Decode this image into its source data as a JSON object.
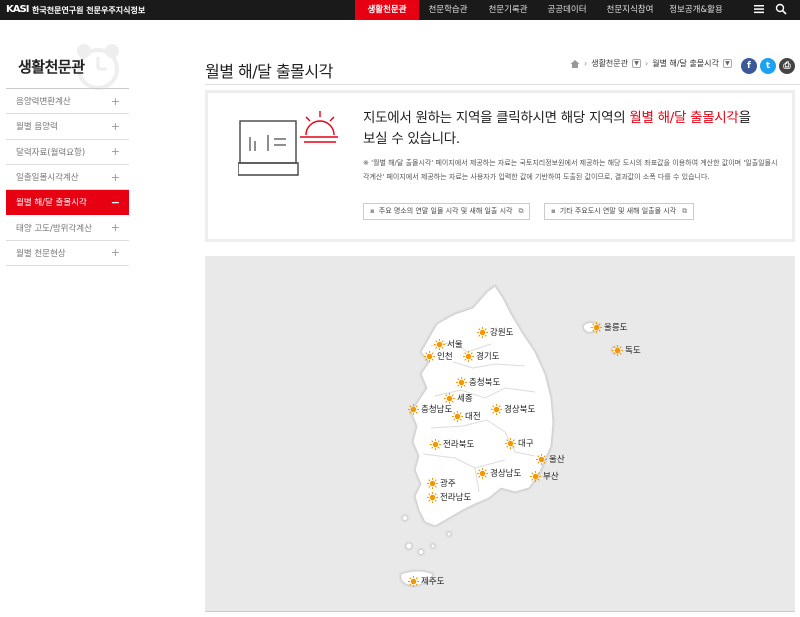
{
  "header": {
    "logo_mark": "KASI",
    "logo_text": "한국천문연구원 천문우주지식정보",
    "nav": [
      "생활천문관",
      "천문학습관",
      "천문기록관",
      "공공데이터",
      "천문지식참여",
      "정보공개&활용"
    ],
    "active_nav": "생활천문관"
  },
  "sidebar": {
    "title": "생활천문관",
    "items": [
      {
        "label": "음양력변환계산",
        "sign": "+"
      },
      {
        "label": "월별 음양력",
        "sign": "+"
      },
      {
        "label": "달력자료(월력요항)",
        "sign": "+"
      },
      {
        "label": "일출일몰시각계산",
        "sign": "+"
      },
      {
        "label": "월별 해/달 출몰시각",
        "sign": "−",
        "active": true
      },
      {
        "label": "태양 고도/방위각계산",
        "sign": "+"
      },
      {
        "label": "월별 천문현상",
        "sign": "+"
      }
    ]
  },
  "page": {
    "title": "월별 해/달 출몰시각",
    "breadcrumb": [
      "생활천문관",
      "월별 해/달 출몰시각"
    ]
  },
  "share": {
    "facebook": "f",
    "twitter": "t",
    "print": "⎙"
  },
  "info": {
    "headline_a": "지도에서 원하는 지역을 클릭하시면 해당 지역의 ",
    "headline_hl": "월별 해/달 출몰시각",
    "headline_b": "을",
    "headline_c": "보실 수 있습니다.",
    "note": "※ '월별 해/달 출몰시각' 페이지에서 제공하는 자료는 국토지리정보원에서 제공하는 해당 도시의 좌표값을 이용하여 계산한 값이며 '일출일몰시각계산' 페이지에서 제공하는 자료는 사용자가 입력한 값에 기반하여 도출된 값이므로, 결과값이 소폭 다를 수 있습니다.",
    "link1": "주요 명소의 연말 일몰 시각 및 새해 일출 시각",
    "link2": "기타 주요도시 연말 및 새해 일출몰 시각"
  },
  "regions": {
    "seoul": "서울",
    "incheon": "인천",
    "gyeonggi": "경기도",
    "gangwon": "강원도",
    "chungbuk": "충청북도",
    "sejong": "세종",
    "chungnam": "충청남도",
    "daejeon": "대전",
    "gyeongbuk": "경상북도",
    "jeonbuk": "전라북도",
    "daegu": "대구",
    "ulsan": "울산",
    "gyeongnam": "경상남도",
    "busan": "부산",
    "gwangju": "광주",
    "jeonnam": "전라남도",
    "jeju": "제주도",
    "ulleung": "울릉도",
    "dokdo": "독도"
  },
  "colors": {
    "accent": "#e60012",
    "sun": "#f39800",
    "map_land": "#ffffff",
    "map_bg": "#e9e9e9"
  }
}
